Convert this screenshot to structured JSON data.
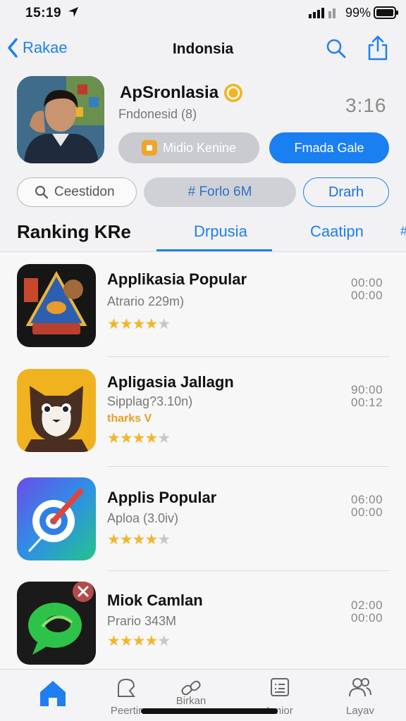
{
  "status": {
    "time": "15:19",
    "battery": "99%"
  },
  "nav": {
    "back": "Rakae",
    "title": "Indonsia"
  },
  "header": {
    "app_name": "ApSronlasia",
    "subtitle": "Fndonesid (8)",
    "counter": "3:16",
    "btn_grey": "Midio Kenine",
    "btn_blue": "Fmada Gale"
  },
  "filters": {
    "search": "Ceestidon",
    "middle": "# Forlo 6M",
    "right": "Drarh"
  },
  "tabs": {
    "heading": "Ranking KRe",
    "items": [
      "Drpusia",
      "Caatipn"
    ],
    "more": "#"
  },
  "apps": [
    {
      "name": "Applikasia Popular",
      "sub": "Atrario 229m)",
      "badge": "",
      "rating": 4.5,
      "t1": "00:00",
      "t2": "00:00"
    },
    {
      "name": "Apligasia Jallagn",
      "sub": "Sipplag?3.10n)",
      "badge": "tharks V",
      "rating": 4.5,
      "t1": "90:00",
      "t2": "00:12"
    },
    {
      "name": "Applis Popular",
      "sub": "Aploa (3.0iv)",
      "badge": "",
      "rating": 4.5,
      "t1": "06:00",
      "t2": "00:00"
    },
    {
      "name": "Miok Camlan",
      "sub": "Prario 343M",
      "badge": "",
      "rating": 4.5,
      "t1": "02:00",
      "t2": "00:00"
    }
  ],
  "tabbar": [
    {
      "label": "",
      "icon": "home-icon"
    },
    {
      "label": "Peertir",
      "icon": "feed-icon"
    },
    {
      "label": "Birkan",
      "icon": "link-icon"
    },
    {
      "label": "Lmior",
      "icon": "list-icon"
    },
    {
      "label": "Layav",
      "icon": "people-icon"
    }
  ]
}
